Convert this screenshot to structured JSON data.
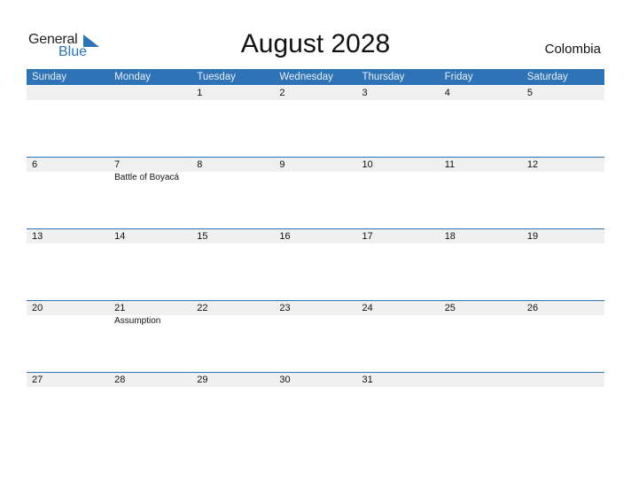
{
  "logo": {
    "general": "General",
    "blue": "Blue",
    "accent": "#2a73b8"
  },
  "title": "August 2028",
  "country": "Colombia",
  "days": [
    "Sunday",
    "Monday",
    "Tuesday",
    "Wednesday",
    "Thursday",
    "Friday",
    "Saturday"
  ],
  "colors": {
    "header": "#2e73b5",
    "strip": "#f0f0f0"
  },
  "weeks": [
    [
      {
        "d": ""
      },
      {
        "d": ""
      },
      {
        "d": "1"
      },
      {
        "d": "2"
      },
      {
        "d": "3"
      },
      {
        "d": "4"
      },
      {
        "d": "5"
      }
    ],
    [
      {
        "d": "6"
      },
      {
        "d": "7",
        "h": "Battle of Boyacá"
      },
      {
        "d": "8"
      },
      {
        "d": "9"
      },
      {
        "d": "10"
      },
      {
        "d": "11"
      },
      {
        "d": "12"
      }
    ],
    [
      {
        "d": "13"
      },
      {
        "d": "14"
      },
      {
        "d": "15"
      },
      {
        "d": "16"
      },
      {
        "d": "17"
      },
      {
        "d": "18"
      },
      {
        "d": "19"
      }
    ],
    [
      {
        "d": "20"
      },
      {
        "d": "21",
        "h": "Assumption"
      },
      {
        "d": "22"
      },
      {
        "d": "23"
      },
      {
        "d": "24"
      },
      {
        "d": "25"
      },
      {
        "d": "26"
      }
    ],
    [
      {
        "d": "27"
      },
      {
        "d": "28"
      },
      {
        "d": "29"
      },
      {
        "d": "30"
      },
      {
        "d": "31"
      },
      {
        "d": ""
      },
      {
        "d": ""
      }
    ]
  ]
}
